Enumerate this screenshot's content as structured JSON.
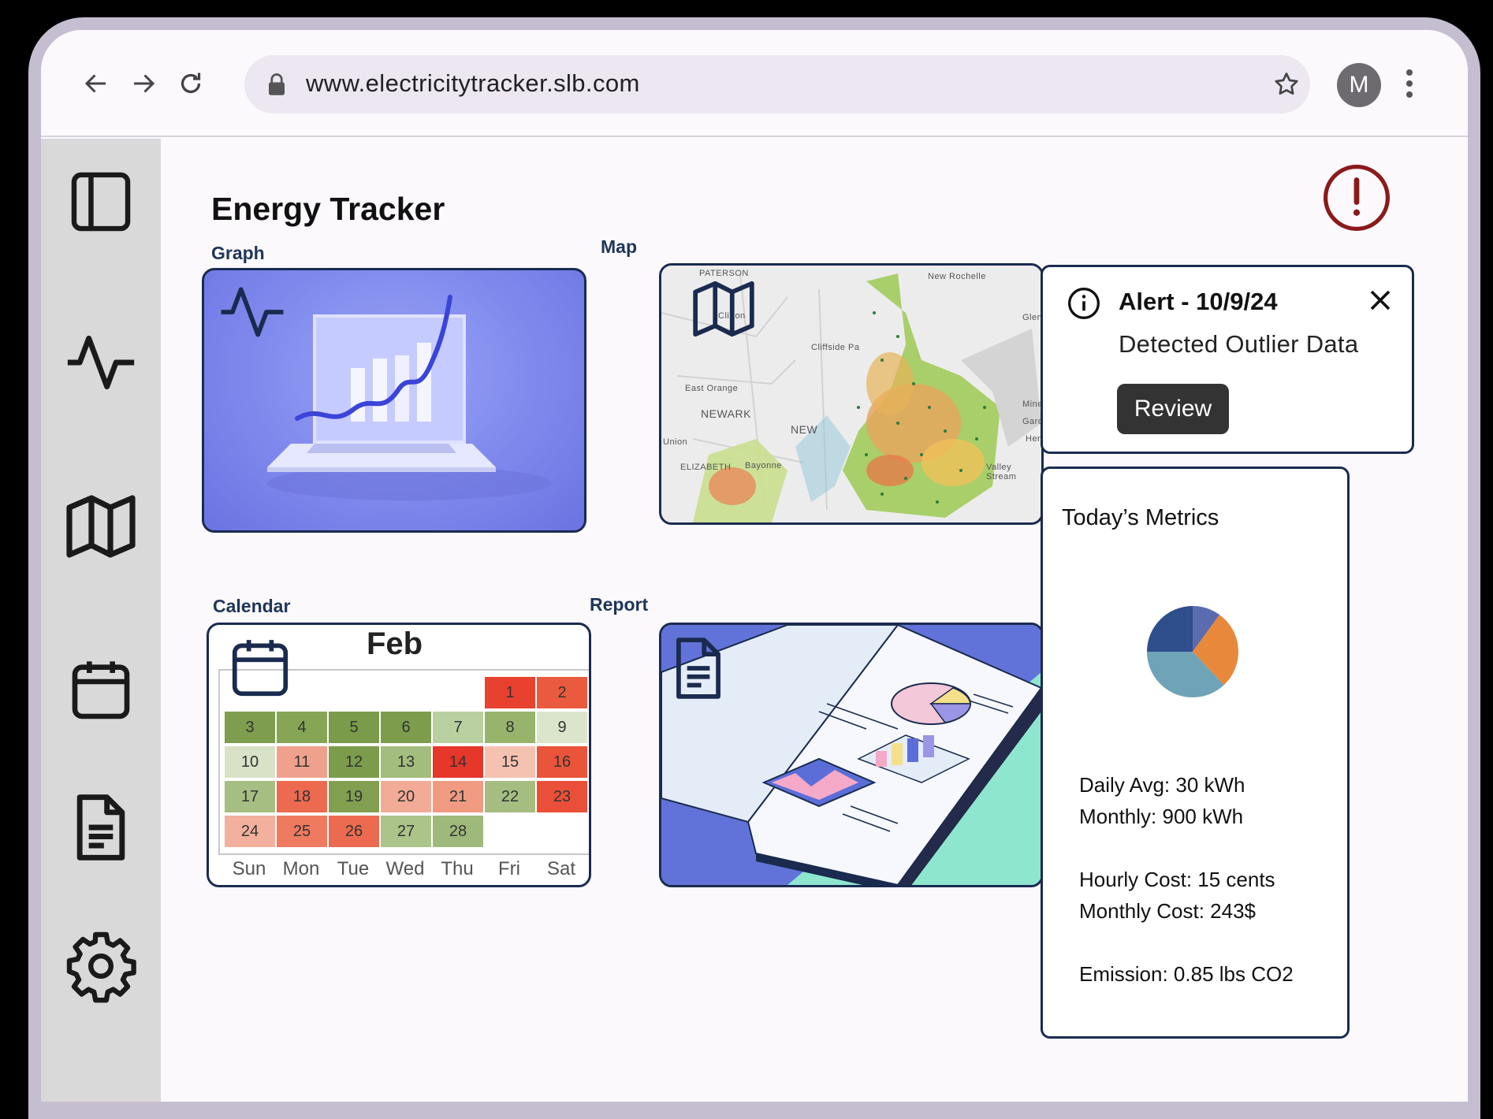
{
  "browser": {
    "url": "www.electricitytracker.slb.com",
    "avatar_initial": "M"
  },
  "page": {
    "title": "Energy Tracker"
  },
  "cards": {
    "graph": {
      "label": "Graph"
    },
    "map": {
      "label": "Map",
      "places": [
        "PATERSON",
        "Clifton",
        "New Rochelle",
        "Cliffside Pa",
        "East Orange",
        "NEWARK",
        "NEW",
        "Union",
        "ELIZABETH",
        "Bayonne",
        "Valley Stream",
        "Glen",
        "Mine",
        "Garde",
        "Hen"
      ]
    },
    "calendar": {
      "label": "Calendar",
      "month": "Feb",
      "days_of_week": [
        "Sun",
        "Mon",
        "Tue",
        "Wed",
        "Thu",
        "Fri",
        "Sat"
      ],
      "days": [
        {
          "d": "1",
          "c": "#e8412f"
        },
        {
          "d": "2",
          "c": "#ea5a3e"
        },
        {
          "d": "3",
          "c": "#7e9e4e"
        },
        {
          "d": "4",
          "c": "#86a656"
        },
        {
          "d": "5",
          "c": "#7a9b4a"
        },
        {
          "d": "6",
          "c": "#7d9d4d"
        },
        {
          "d": "7",
          "c": "#b9cfa0"
        },
        {
          "d": "8",
          "c": "#98b46c"
        },
        {
          "d": "9",
          "c": "#dbe5cb"
        },
        {
          "d": "10",
          "c": "#d9e2c6"
        },
        {
          "d": "11",
          "c": "#f0a18e"
        },
        {
          "d": "12",
          "c": "#7c9c4c"
        },
        {
          "d": "13",
          "c": "#a3bd7e"
        },
        {
          "d": "14",
          "c": "#e7362a"
        },
        {
          "d": "15",
          "c": "#f5c2b2"
        },
        {
          "d": "16",
          "c": "#ea543a"
        },
        {
          "d": "17",
          "c": "#a6be81"
        },
        {
          "d": "18",
          "c": "#ec6a4f"
        },
        {
          "d": "19",
          "c": "#829f50"
        },
        {
          "d": "20",
          "c": "#f2ab96"
        },
        {
          "d": "21",
          "c": "#f09a82"
        },
        {
          "d": "22",
          "c": "#a5bd80"
        },
        {
          "d": "23",
          "c": "#ea5039"
        },
        {
          "d": "24",
          "c": "#f3b09c"
        },
        {
          "d": "25",
          "c": "#ee7a5f"
        },
        {
          "d": "26",
          "c": "#ec6a4f"
        },
        {
          "d": "27",
          "c": "#acc389"
        },
        {
          "d": "28",
          "c": "#9fb97a"
        }
      ]
    },
    "report": {
      "label": "Report"
    }
  },
  "alert": {
    "title": "Alert - 10/9/24",
    "message": "Detected Outlier Data",
    "button": "Review"
  },
  "metrics": {
    "title": "Today’s Metrics",
    "daily_avg": "Daily Avg: 30 kWh",
    "monthly": "Monthly: 900 kWh",
    "hourly_cost": "Hourly Cost: 15 cents",
    "monthly_cost": "Monthly Cost: 243$",
    "emission": "Emission:  0.85 lbs CO2",
    "pie_slices": [
      {
        "share": 0.1,
        "color": "#5b6bb0"
      },
      {
        "share": 0.28,
        "color": "#e8883a"
      },
      {
        "share": 0.37,
        "color": "#6fa3b8"
      },
      {
        "share": 0.25,
        "color": "#2f4e8c"
      }
    ]
  },
  "colors": {
    "navy": "#1a2b4f",
    "alert_red": "#8b1a1a",
    "sidebar_bg": "#d9d9d9"
  }
}
